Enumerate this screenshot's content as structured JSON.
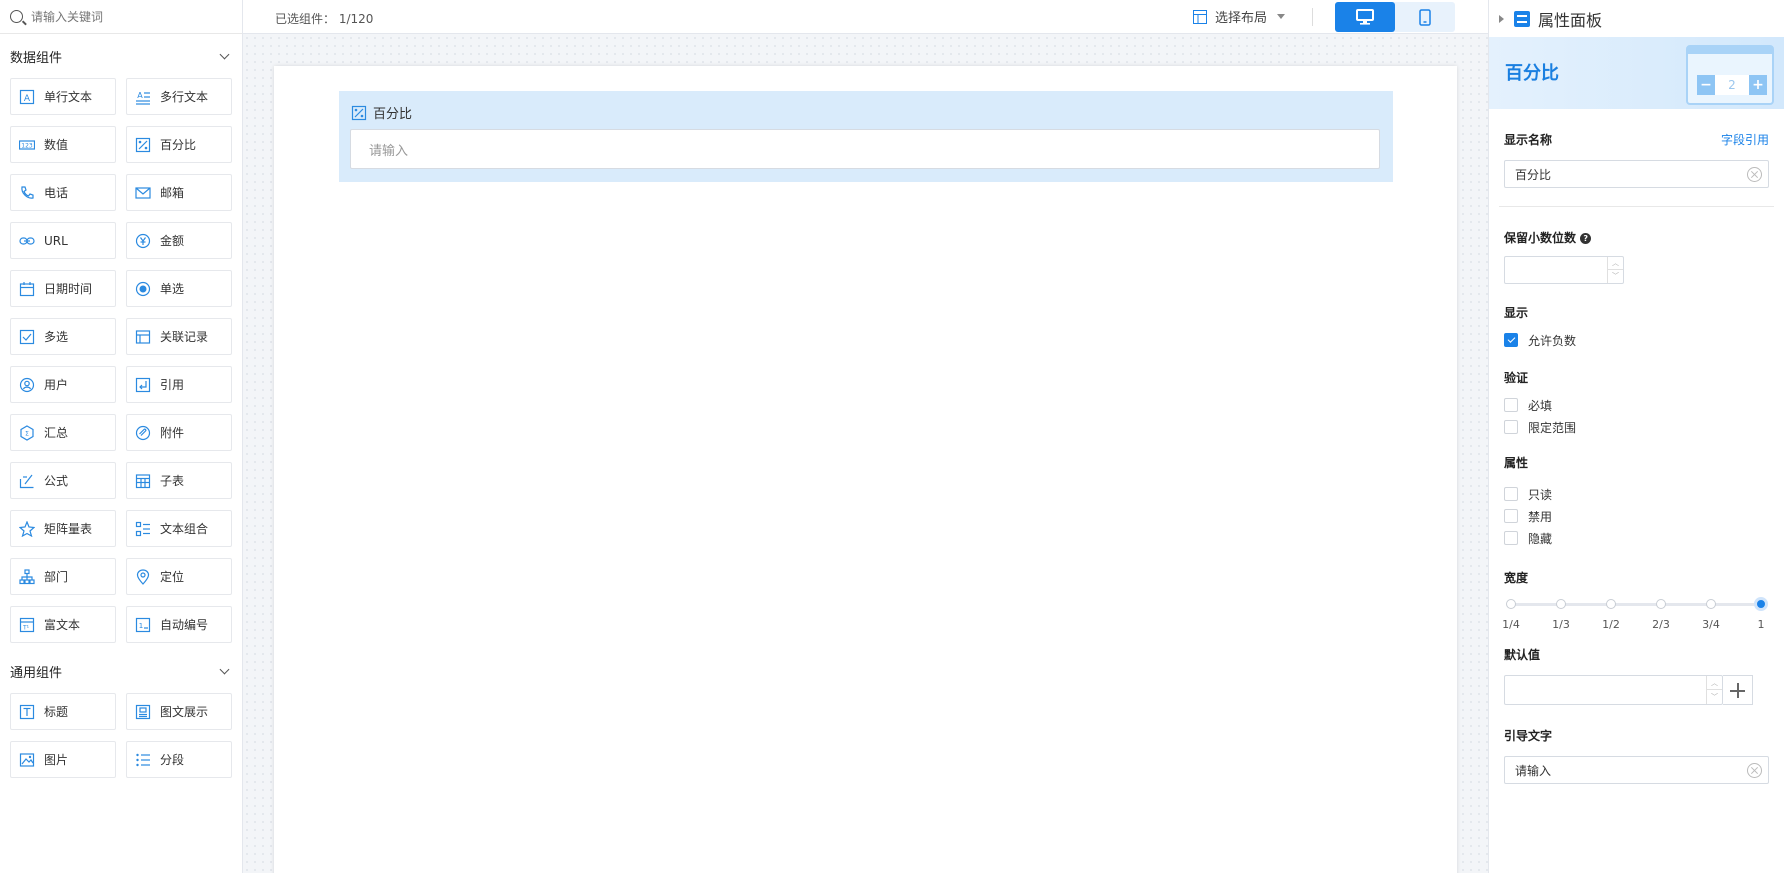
{
  "search": {
    "placeholder": "请输入关键词"
  },
  "groups": {
    "data": {
      "title": "数据组件",
      "items": [
        {
          "label": "单行文本",
          "icon": "single-line-text-icon"
        },
        {
          "label": "多行文本",
          "icon": "multi-line-text-icon"
        },
        {
          "label": "数值",
          "icon": "number-icon"
        },
        {
          "label": "百分比",
          "icon": "percent-icon"
        },
        {
          "label": "电话",
          "icon": "phone-icon"
        },
        {
          "label": "邮箱",
          "icon": "mail-icon"
        },
        {
          "label": "URL",
          "icon": "link-icon"
        },
        {
          "label": "金额",
          "icon": "currency-icon"
        },
        {
          "label": "日期时间",
          "icon": "calendar-icon"
        },
        {
          "label": "单选",
          "icon": "radio-icon"
        },
        {
          "label": "多选",
          "icon": "checkbox-icon"
        },
        {
          "label": "关联记录",
          "icon": "relation-icon"
        },
        {
          "label": "用户",
          "icon": "user-icon"
        },
        {
          "label": "引用",
          "icon": "reference-icon"
        },
        {
          "label": "汇总",
          "icon": "summary-icon"
        },
        {
          "label": "附件",
          "icon": "attachment-icon"
        },
        {
          "label": "公式",
          "icon": "formula-icon"
        },
        {
          "label": "子表",
          "icon": "subtable-icon"
        },
        {
          "label": "矩阵量表",
          "icon": "matrix-icon"
        },
        {
          "label": "文本组合",
          "icon": "text-combo-icon"
        },
        {
          "label": "部门",
          "icon": "department-icon"
        },
        {
          "label": "定位",
          "icon": "location-icon"
        },
        {
          "label": "富文本",
          "icon": "rich-text-icon"
        },
        {
          "label": "自动编号",
          "icon": "auto-number-icon"
        }
      ]
    },
    "general": {
      "title": "通用组件",
      "items": [
        {
          "label": "标题",
          "icon": "heading-icon"
        },
        {
          "label": "图文展示",
          "icon": "image-text-icon"
        },
        {
          "label": "图片",
          "icon": "image-icon"
        },
        {
          "label": "分段",
          "icon": "section-icon"
        }
      ]
    }
  },
  "topbar": {
    "selected_label": "已选组件：",
    "selected_count": "1/120",
    "layout_label": "选择布局"
  },
  "canvas": {
    "field_label": "百分比",
    "field_placeholder": "请输入"
  },
  "panel": {
    "title": "属性面板",
    "banner_title": "百分比",
    "banner_value": "2",
    "display_name_label": "显示名称",
    "field_ref_link": "字段引用",
    "display_name_value": "百分比",
    "decimal_label": "保留小数位数",
    "display_section": "显示",
    "allow_negative": "允许负数",
    "allow_negative_checked": true,
    "validation_section": "验证",
    "required": "必填",
    "limit_range": "限定范围",
    "attr_section": "属性",
    "readonly": "只读",
    "disabled": "禁用",
    "hidden": "隐藏",
    "width_section": "宽度",
    "width_ticks": [
      "1/4",
      "1/3",
      "1/2",
      "2/3",
      "3/4",
      "1"
    ],
    "width_selected": "1",
    "default_section": "默认值",
    "guide_section": "引导文字",
    "guide_value": "请输入"
  },
  "colors": {
    "accent": "#1a82e8",
    "field_bg": "#d9ebfb"
  }
}
